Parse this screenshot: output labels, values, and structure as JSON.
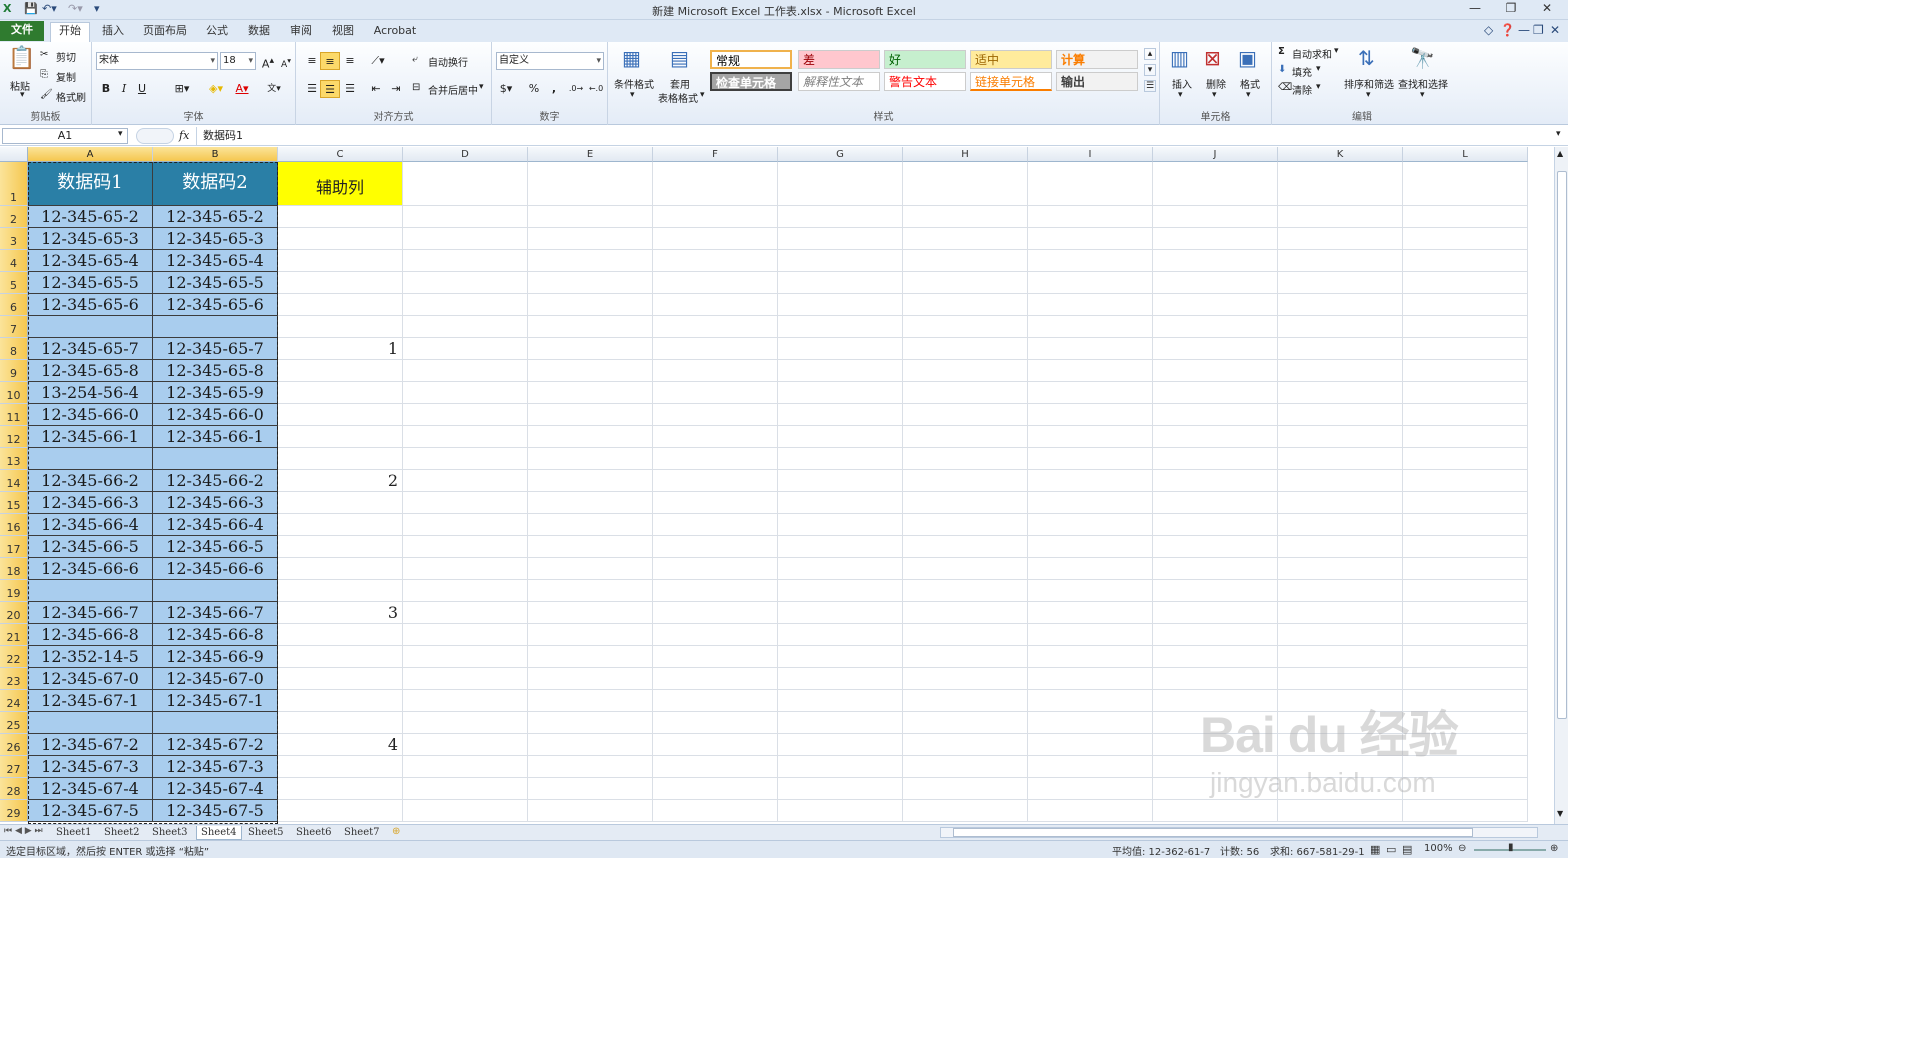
{
  "window": {
    "title": "新建 Microsoft Excel 工作表.xlsx  -  Microsoft Excel"
  },
  "tabs": [
    "文件",
    "开始",
    "插入",
    "页面布局",
    "公式",
    "数据",
    "审阅",
    "视图",
    "Acrobat"
  ],
  "active_tab": "开始",
  "ribbon": {
    "clipboard": {
      "paste": "粘贴",
      "cut": "剪切",
      "copy": "复制",
      "format_painter": "格式刷",
      "label": "剪贴板"
    },
    "font": {
      "name": "宋体",
      "size": "18",
      "bold": "B",
      "italic": "I",
      "underline": "U",
      "label": "字体"
    },
    "alignment": {
      "wrap": "自动换行",
      "merge": "合并后居中",
      "label": "对齐方式"
    },
    "number": {
      "format": "自定义",
      "percent": "%",
      "comma": ",",
      "label": "数字"
    },
    "styles": {
      "conditional": "条件格式",
      "table_format_1": "套用",
      "table_format_2": "表格格式",
      "items": [
        {
          "label": "常规",
          "bg": "#ffffff",
          "color": "#000000"
        },
        {
          "label": "差",
          "bg": "#ffc7ce",
          "color": "#9c0006"
        },
        {
          "label": "好",
          "bg": "#c6efce",
          "color": "#006100"
        },
        {
          "label": "适中",
          "bg": "#ffeb9c",
          "color": "#9c6500"
        },
        {
          "label": "计算",
          "bg": "#f2f2f2",
          "color": "#fa7d00"
        },
        {
          "label": "检查单元格",
          "bg": "#a5a5a5",
          "color": "#ffffff"
        },
        {
          "label": "解释性文本",
          "bg": "#ffffff",
          "color": "#7f7f7f"
        },
        {
          "label": "警告文本",
          "bg": "#ffffff",
          "color": "#ff0000"
        },
        {
          "label": "链接单元格",
          "bg": "#ffffff",
          "color": "#fa7d00"
        },
        {
          "label": "输出",
          "bg": "#f2f2f2",
          "color": "#3f3f3f"
        }
      ],
      "label": "样式"
    },
    "cells": {
      "insert": "插入",
      "delete": "删除",
      "format": "格式",
      "label": "单元格"
    },
    "editing": {
      "autosum": "自动求和",
      "fill": "填充",
      "clear": "清除",
      "sort": "排序和筛选",
      "find": "查找和选择",
      "label": "编辑"
    }
  },
  "formula_bar": {
    "name_box": "A1",
    "fx": "fx",
    "content": "数据码1"
  },
  "columns": [
    "A",
    "B",
    "C",
    "D",
    "E",
    "F",
    "G",
    "H",
    "I",
    "J",
    "K",
    "L"
  ],
  "rows": [
    {
      "n": "1",
      "a": "数据码1",
      "b": "数据码2",
      "c": "辅助列"
    },
    {
      "n": "2",
      "a": "12-345-65-2",
      "b": "12-345-65-2",
      "c": ""
    },
    {
      "n": "3",
      "a": "12-345-65-3",
      "b": "12-345-65-3",
      "c": ""
    },
    {
      "n": "4",
      "a": "12-345-65-4",
      "b": "12-345-65-4",
      "c": ""
    },
    {
      "n": "5",
      "a": "12-345-65-5",
      "b": "12-345-65-5",
      "c": ""
    },
    {
      "n": "6",
      "a": "12-345-65-6",
      "b": "12-345-65-6",
      "c": ""
    },
    {
      "n": "7",
      "a": "",
      "b": "",
      "c": ""
    },
    {
      "n": "8",
      "a": "12-345-65-7",
      "b": "12-345-65-7",
      "c": "1"
    },
    {
      "n": "9",
      "a": "12-345-65-8",
      "b": "12-345-65-8",
      "c": ""
    },
    {
      "n": "10",
      "a": "13-254-56-4",
      "b": "12-345-65-9",
      "c": ""
    },
    {
      "n": "11",
      "a": "12-345-66-0",
      "b": "12-345-66-0",
      "c": ""
    },
    {
      "n": "12",
      "a": "12-345-66-1",
      "b": "12-345-66-1",
      "c": ""
    },
    {
      "n": "13",
      "a": "",
      "b": "",
      "c": ""
    },
    {
      "n": "14",
      "a": "12-345-66-2",
      "b": "12-345-66-2",
      "c": "2"
    },
    {
      "n": "15",
      "a": "12-345-66-3",
      "b": "12-345-66-3",
      "c": ""
    },
    {
      "n": "16",
      "a": "12-345-66-4",
      "b": "12-345-66-4",
      "c": ""
    },
    {
      "n": "17",
      "a": "12-345-66-5",
      "b": "12-345-66-5",
      "c": ""
    },
    {
      "n": "18",
      "a": "12-345-66-6",
      "b": "12-345-66-6",
      "c": ""
    },
    {
      "n": "19",
      "a": "",
      "b": "",
      "c": ""
    },
    {
      "n": "20",
      "a": "12-345-66-7",
      "b": "12-345-66-7",
      "c": "3"
    },
    {
      "n": "21",
      "a": "12-345-66-8",
      "b": "12-345-66-8",
      "c": ""
    },
    {
      "n": "22",
      "a": "12-352-14-5",
      "b": "12-345-66-9",
      "c": ""
    },
    {
      "n": "23",
      "a": "12-345-67-0",
      "b": "12-345-67-0",
      "c": ""
    },
    {
      "n": "24",
      "a": "12-345-67-1",
      "b": "12-345-67-1",
      "c": ""
    },
    {
      "n": "25",
      "a": "",
      "b": "",
      "c": ""
    },
    {
      "n": "26",
      "a": "12-345-67-2",
      "b": "12-345-67-2",
      "c": "4"
    },
    {
      "n": "27",
      "a": "12-345-67-3",
      "b": "12-345-67-3",
      "c": ""
    },
    {
      "n": "28",
      "a": "12-345-67-4",
      "b": "12-345-67-4",
      "c": ""
    },
    {
      "n": "29",
      "a": "12-345-67-5",
      "b": "12-345-67-5",
      "c": ""
    }
  ],
  "sheets": [
    "Sheet1",
    "Sheet2",
    "Sheet3",
    "Sheet4",
    "Sheet5",
    "Sheet6",
    "Sheet7"
  ],
  "status": {
    "message": "选定目标区域，然后按 ENTER 或选择 “粘贴”",
    "average": "平均值: 12-362-61-7",
    "count": "计数: 56",
    "sum": "求和: 667-581-29-1",
    "zoom": "100%"
  },
  "watermark": {
    "brand": "Bai du 经验",
    "url": "jingyan.baidu.com"
  }
}
